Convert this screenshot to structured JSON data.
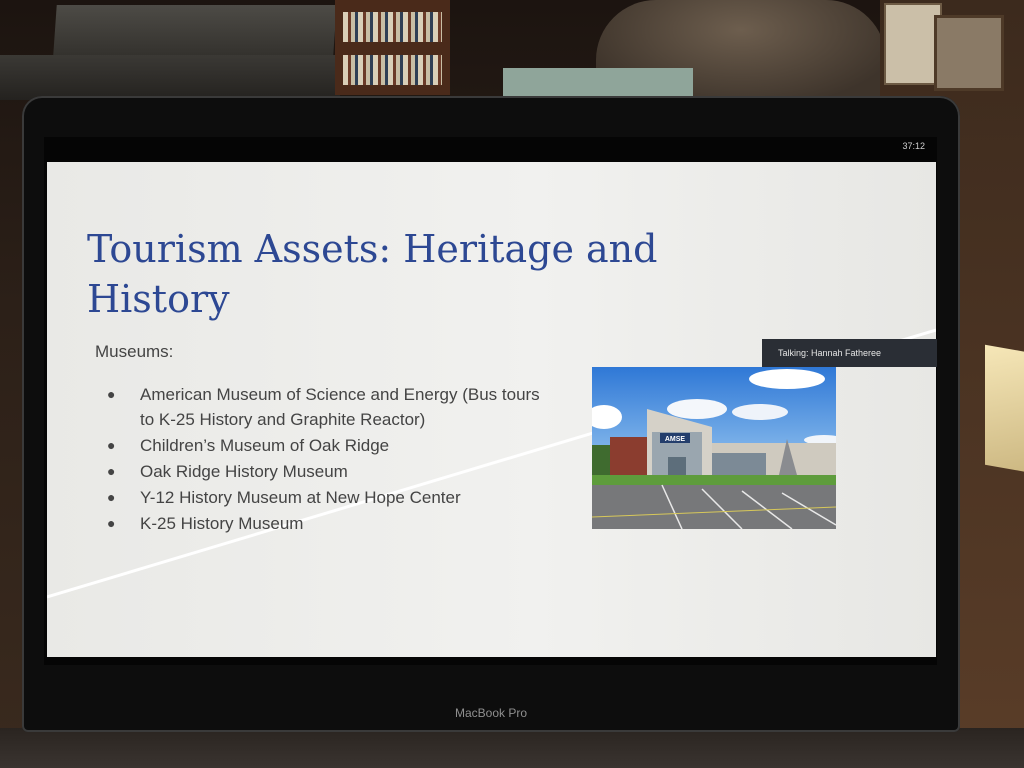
{
  "meeting": {
    "timer": "37:12",
    "speaker_label": "Talking: Hannah Fatheree"
  },
  "slide": {
    "title": "Tourism Assets: Heritage and History",
    "section_label": "Museums:",
    "bullets": [
      "American Museum of Science and Energy (Bus tours to K-25 History and Graphite Reactor)",
      "Children’s Museum of Oak Ridge",
      "Oak Ridge History Museum",
      "Y-12 History Museum at New Hope Center",
      "K-25 History Museum"
    ],
    "photo": {
      "sign_text": "AMSE"
    }
  },
  "device": {
    "brand": "MacBook Pro"
  },
  "colors": {
    "title": "#2d4893",
    "body_text": "#444444",
    "slide_bg": "#eeeeec",
    "banner_bg": "#2a2e35"
  }
}
